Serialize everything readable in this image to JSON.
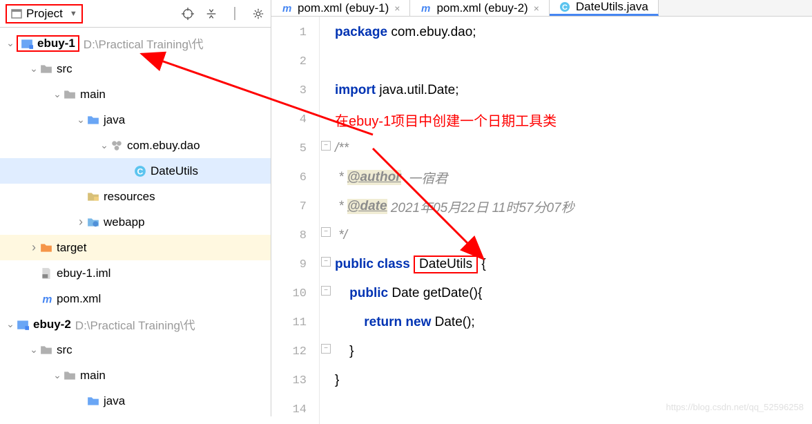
{
  "sidebar": {
    "title": "Project",
    "tree": {
      "proj1": {
        "name": "ebuy-1",
        "path": "D:\\Practical Training\\代"
      },
      "src1": "src",
      "main1": "main",
      "java1": "java",
      "pkg1": "com.ebuy.dao",
      "cls1": "DateUtils",
      "res1": "resources",
      "web1": "webapp",
      "tgt1": "target",
      "iml1": "ebuy-1.iml",
      "pom1": "pom.xml",
      "proj2": {
        "name": "ebuy-2",
        "path": "D:\\Practical Training\\代"
      },
      "src2": "src",
      "main2": "main",
      "java2": "java"
    }
  },
  "tabs": [
    {
      "label": "pom.xml (ebuy-1)",
      "icon": "m"
    },
    {
      "label": "pom.xml (ebuy-2)",
      "icon": "m"
    },
    {
      "label": "DateUtils.java",
      "icon": "c",
      "active": true
    }
  ],
  "gutter": [
    "1",
    "2",
    "3",
    "4",
    "5",
    "6",
    "7",
    "8",
    "9",
    "10",
    "11",
    "12",
    "13",
    "14"
  ],
  "code": {
    "l1a": "package",
    "l1b": " com.ebuy.dao;",
    "l3a": "import",
    "l3b": " java.util.Date;",
    "l5": "/**",
    "l6a": " * ",
    "l6tag": "@author",
    "l6b": "  一宿君",
    "l7a": " * ",
    "l7tag": "@date",
    "l7b": " 2021年05月22日 11时57分07秒",
    "l8": " */",
    "l9a": "public class ",
    "l9b": "DateUtils",
    "l9c": " {",
    "l10a": "    ",
    "l10b": "public",
    "l10c": " Date getDate(){",
    "l11a": "        ",
    "l11b": "return new",
    "l11c": " Date();",
    "l12": "    }",
    "l13": "}"
  },
  "annotation": "在ebuy-1项目中创建一个日期工具类",
  "watermark": "https://blog.csdn.net/qq_52596258"
}
